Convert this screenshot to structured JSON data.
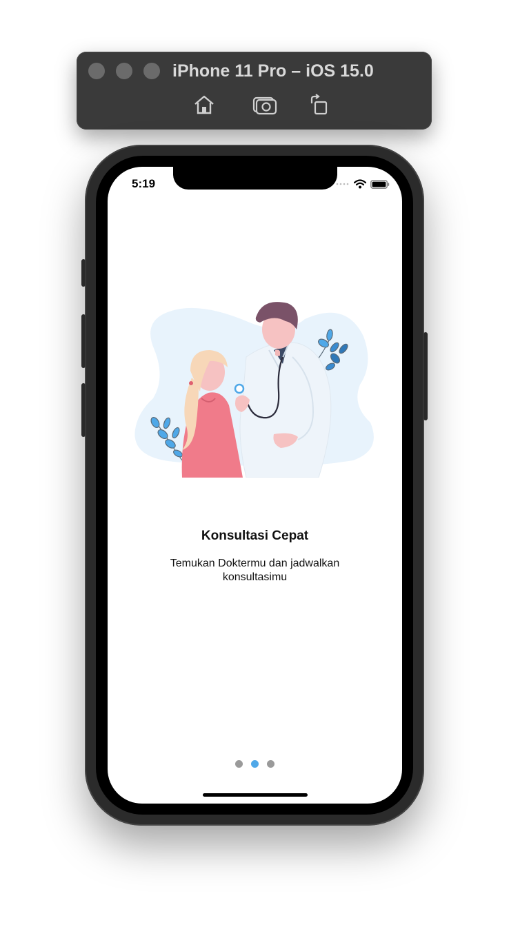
{
  "simulator": {
    "title": "iPhone 11 Pro – iOS 15.0",
    "tools": [
      "home-icon",
      "screenshot-icon",
      "rotate-icon"
    ]
  },
  "status_bar": {
    "time": "5:19"
  },
  "onboarding": {
    "title": "Konsultasi Cepat",
    "subtitle": "Temukan Doktermu dan jadwalkan konsultasimu",
    "page_count": 3,
    "active_page": 2
  },
  "colors": {
    "accent": "#4fa8e8",
    "inactive_dot": "#9a9a9a",
    "blob": "#e8f3fc",
    "patient_dress": "#f07b8a"
  }
}
